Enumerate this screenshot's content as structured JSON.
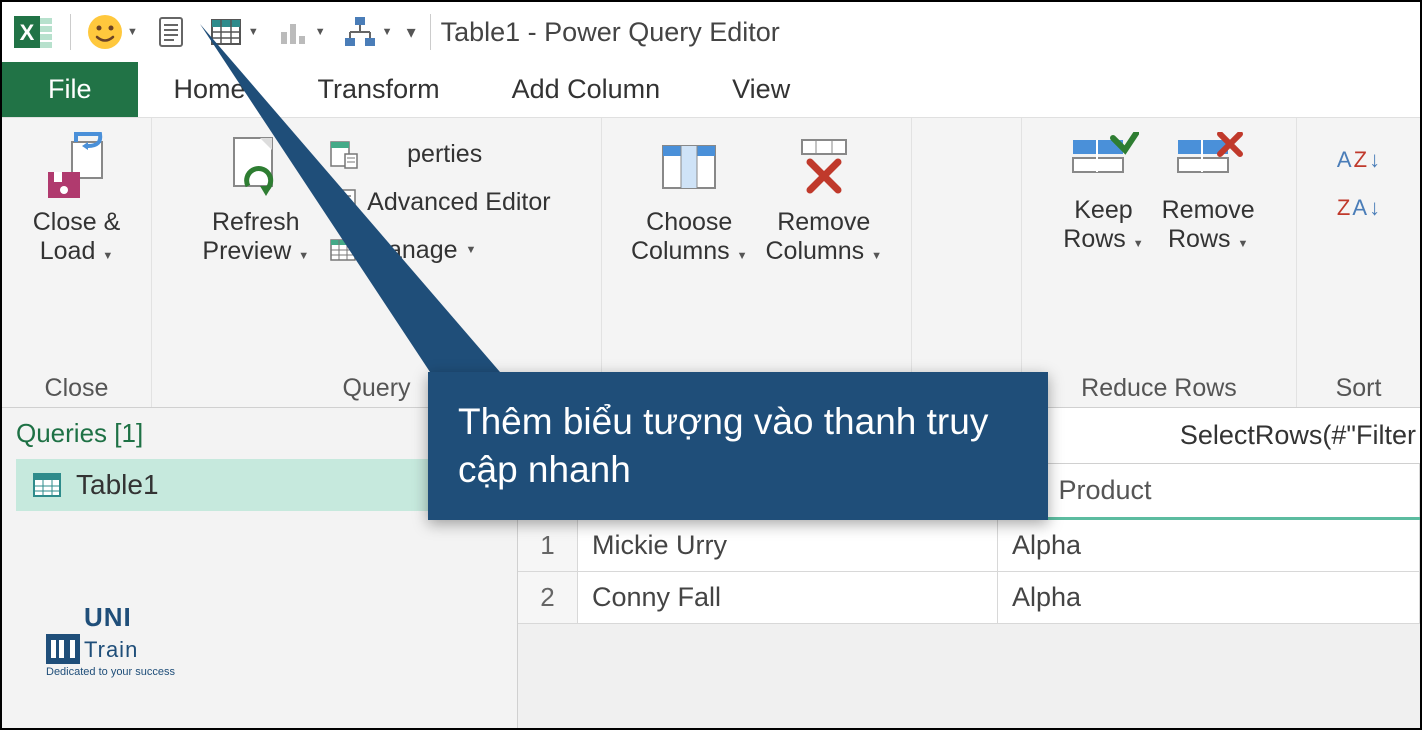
{
  "title": "Table1 - Power Query Editor",
  "tabs": {
    "file": "File",
    "home": "Home",
    "transform": "Transform",
    "addcol": "Add Column",
    "view": "View"
  },
  "ribbon": {
    "close": {
      "btn": "Close &\nLoad",
      "group": "Close"
    },
    "query": {
      "refresh": "Refresh\nPreview",
      "properties": "Perties",
      "advanced": "Advanced Editor",
      "manage": "Manage",
      "group": "Query"
    },
    "cols": {
      "choose": "Choose\nColumns",
      "remove": "Remove\nColumns"
    },
    "rows": {
      "keep": "Keep\nRows",
      "remove": "Remove\nRows",
      "group": "Reduce Rows"
    },
    "sort": {
      "group": "Sort"
    }
  },
  "queries": {
    "header": "Queries [1]",
    "items": [
      "Table1"
    ]
  },
  "formula": "SelectRows(#\"Filter",
  "grid": {
    "headers": [
      "",
      "Product"
    ],
    "rows": [
      {
        "n": "1",
        "c1": "Mickie Urry",
        "c2": "Alpha"
      },
      {
        "n": "2",
        "c1": "Conny Fall",
        "c2": "Alpha"
      }
    ]
  },
  "callout": "Thêm biểu tượng vào thanh truy cập nhanh",
  "logo": {
    "top": "UNI",
    "bottom": "Train",
    "sub": "Dedicated to your success"
  }
}
